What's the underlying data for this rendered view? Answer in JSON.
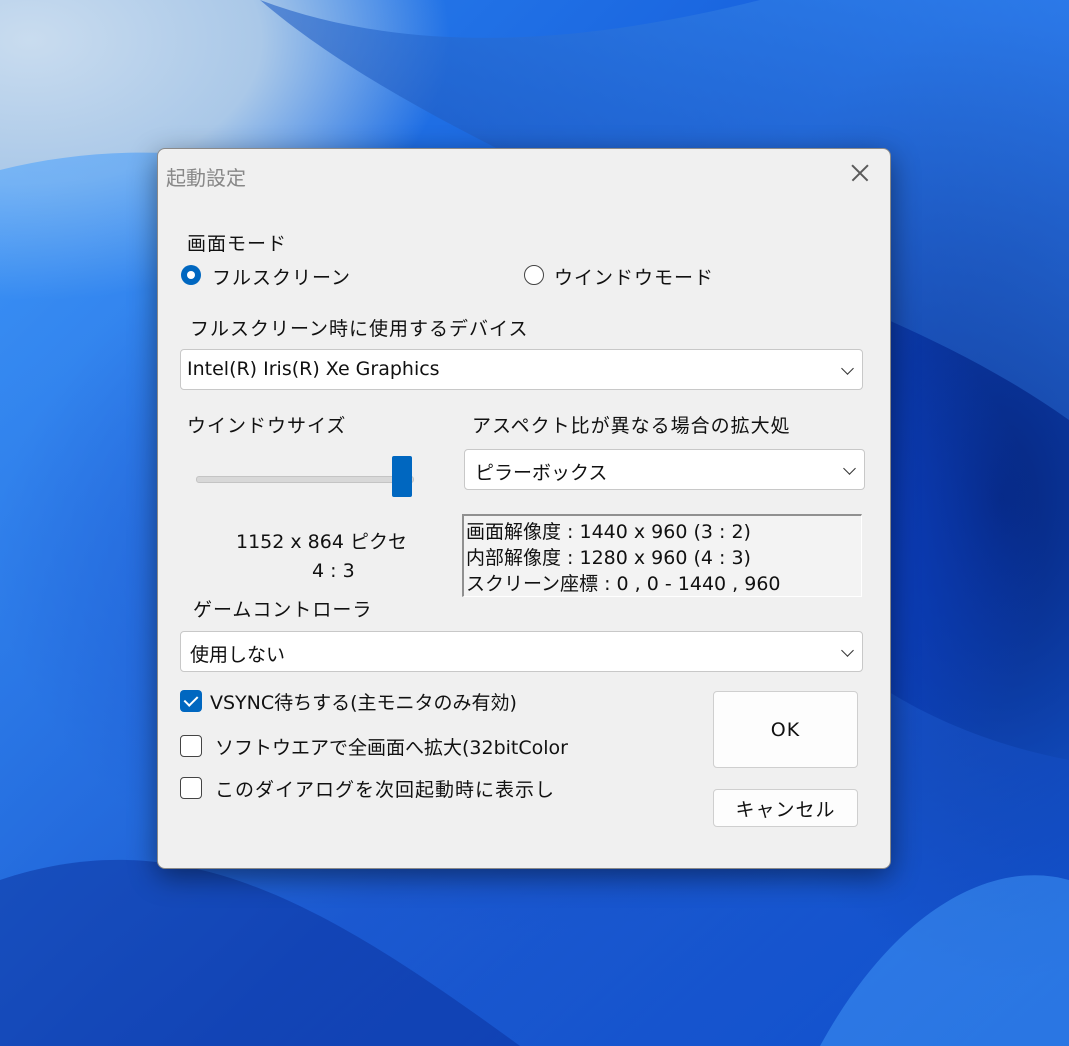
{
  "dialog": {
    "title": "起動設定"
  },
  "screen_mode": {
    "label": "画面モード",
    "fullscreen_label": "フルスクリーン",
    "window_label": "ウインドウモード",
    "selected": "fullscreen"
  },
  "device": {
    "label": "フルスクリーン時に使用するデバイス",
    "value": "Intel(R) Iris(R) Xe Graphics"
  },
  "window_size": {
    "label": "ウインドウサイズ",
    "slider_level": 1.0,
    "size_text": "1152 x 864 ピクセ",
    "ratio_text": "4 : 3"
  },
  "aspect": {
    "label": "アスペクト比が異なる場合の拡大処",
    "value": "ピラーボックス"
  },
  "info": {
    "line1": "画面解像度 : 1440 x 960 (3 : 2)",
    "line2": "内部解像度 : 1280 x 960 (4 : 3)",
    "line3": "スクリーン座標 : 0 , 0 - 1440 , 960"
  },
  "controller": {
    "label": "ゲームコントローラ",
    "value": "使用しない"
  },
  "options": {
    "vsync_label": "VSYNC待ちする(主モニタのみ有効)",
    "vsync_checked": true,
    "software_label": "ソフトウエアで全画面へ拡大(32bitColor",
    "software_checked": false,
    "show_dialog_label": "このダイアログを次回起動時に表示し",
    "show_dialog_checked": false
  },
  "buttons": {
    "ok": "OK",
    "cancel": "キャンセル"
  },
  "colors": {
    "accent": "#0067c0",
    "dialog_bg": "#f0f0f0",
    "wallpaper_blue": "#1a66e0"
  }
}
